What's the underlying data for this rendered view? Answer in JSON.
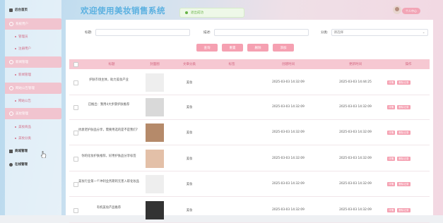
{
  "header": {
    "title": "欢迎使用美妆销售系统",
    "toast": "退出成功",
    "user_label": "个人中心"
  },
  "sidebar": {
    "items": [
      {
        "label": "后台首页",
        "type": "top"
      },
      {
        "label": "系统用户",
        "type": "group"
      },
      {
        "label": "管理员",
        "type": "sub"
      },
      {
        "label": "注册用户",
        "type": "sub"
      },
      {
        "label": "新闻管理",
        "type": "group"
      },
      {
        "label": "新闻管理",
        "type": "sub"
      },
      {
        "label": "网站公告管理",
        "type": "group"
      },
      {
        "label": "网站公告",
        "type": "sub"
      },
      {
        "label": "美妆管理",
        "type": "group"
      },
      {
        "label": "美妆商品",
        "type": "sub"
      },
      {
        "label": "美妆分类",
        "type": "sub"
      },
      {
        "label": "商城管理",
        "type": "top"
      },
      {
        "label": "在线管理",
        "type": "top"
      }
    ]
  },
  "search": {
    "field1_label": "标题:",
    "field2_label": "描述:",
    "field3_label": "分类:",
    "select_placeholder": "请选择"
  },
  "buttons": {
    "query": "查询",
    "reset": "重置",
    "delete": "删除",
    "add": "添加"
  },
  "table": {
    "headers": [
      "标题",
      "封面图",
      "文章分类",
      "标签",
      "创建时间",
      "更新时间",
      "操作"
    ],
    "ops": [
      "详情",
      "删除记录"
    ],
    "rows": [
      {
        "title": "护肤市场主体，助力美妆产业",
        "category": "美妆",
        "created": "2025-03-03 14:32:09",
        "updated": "2025-03-03 14:44:25",
        "thumb": "#eeeeee"
      },
      {
        "title": "已推出：我用4大步骤护肤推荐",
        "category": "美妆",
        "created": "2025-03-03 14:32:09",
        "updated": "2025-03-03 14:32:09",
        "thumb": "#d9d9d9"
      },
      {
        "title": "抗衰老护肤品分享，需要用选的是不是我们？",
        "category": "美妆",
        "created": "2025-03-03 14:32:09",
        "updated": "2025-03-03 14:32:09",
        "thumb": "#b58a6a"
      },
      {
        "title": "你的化妆护肤推荐，好用护肤品分享标签",
        "category": "美妆",
        "created": "2025-03-03 14:32:09",
        "updated": "2025-03-03 14:32:09",
        "thumb": "#e3c0a8"
      },
      {
        "title": "美妆行业第一个冲刺业务期的无害入职化妆品",
        "category": "美妆",
        "created": "2025-03-03 14:32:09",
        "updated": "2025-03-03 14:32:09",
        "thumb": "#eeeeee"
      },
      {
        "title": "有机美妆产品推荐",
        "category": "美妆",
        "created": "2025-03-03 14:32:09",
        "updated": "2025-03-03 14:32:09",
        "thumb": "#333333"
      }
    ]
  },
  "colors": {
    "accent": "#f5a0b1",
    "header_pink": "#f6c8d2",
    "title_blue": "#5ab0e0"
  }
}
